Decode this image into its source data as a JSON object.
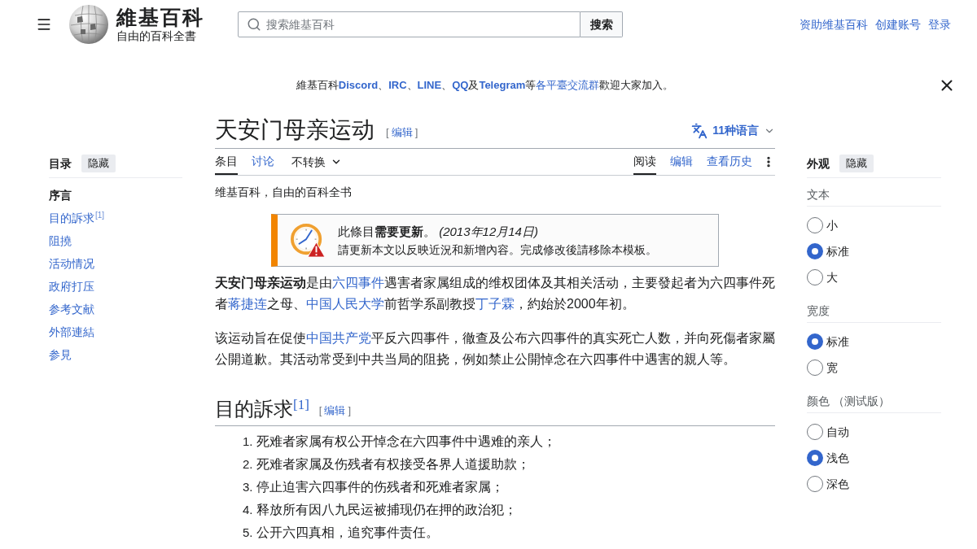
{
  "header": {
    "site_name": "維基百科",
    "tagline": "自由的百科全書",
    "search": {
      "placeholder": "搜索維基百科",
      "button": "搜索"
    },
    "user_links": [
      "资助维基百科",
      "创建账号",
      "登录"
    ]
  },
  "banner": {
    "segments": [
      {
        "kind": "text",
        "text": "維基百科"
      },
      {
        "kind": "bold_link",
        "text": "Discord"
      },
      {
        "kind": "text",
        "text": "、"
      },
      {
        "kind": "bold_link",
        "text": "IRC"
      },
      {
        "kind": "text",
        "text": "、"
      },
      {
        "kind": "bold_link",
        "text": "LINE"
      },
      {
        "kind": "text",
        "text": "、"
      },
      {
        "kind": "bold_link",
        "text": "QQ"
      },
      {
        "kind": "text",
        "text": "及"
      },
      {
        "kind": "bold_link",
        "text": "Telegram"
      },
      {
        "kind": "text",
        "text": "等"
      },
      {
        "kind": "link",
        "text": "各平臺交流群"
      },
      {
        "kind": "text",
        "text": "歡迎大家加入。"
      }
    ]
  },
  "toc": {
    "title": "目录",
    "hide_button": "隐藏",
    "items": [
      {
        "label": "序言",
        "selected": true
      },
      {
        "label": "目的訴求",
        "note": "[1]",
        "selected": false
      },
      {
        "label": "阻撓",
        "selected": false
      },
      {
        "label": "活动情况",
        "selected": false
      },
      {
        "label": "政府打压",
        "selected": false
      },
      {
        "label": "参考文献",
        "selected": false
      },
      {
        "label": "外部連結",
        "selected": false
      },
      {
        "label": "参見",
        "selected": false
      }
    ]
  },
  "article": {
    "title": "天安门母亲运动",
    "title_edit": {
      "open": "[",
      "label": "编辑",
      "close": "]"
    },
    "languages": "11种语言",
    "tabs": [
      {
        "label": "条目",
        "selected": true
      },
      {
        "label": "讨论",
        "selected": false
      }
    ],
    "variant": "不转换",
    "views": [
      {
        "label": "阅读",
        "selected": true
      },
      {
        "label": "编辑",
        "selected": false
      },
      {
        "label": "查看历史",
        "selected": false
      }
    ],
    "tagline": "维基百科，自由的百科全书",
    "notice": {
      "title": "此條目**需要更新**。 *(2013年12月14日)*",
      "text": "請更新本文以反映近況和新增內容。完成修改後請移除本模板。"
    },
    "paragraphs": [
      [
        {
          "kind": "bold",
          "text": "天安门母亲运动"
        },
        {
          "kind": "text",
          "text": "是由"
        },
        {
          "kind": "link",
          "text": "六四事件"
        },
        {
          "kind": "text",
          "text": "遇害者家属组成的维权团体及其相关活动，主要發起者为六四事件死者"
        },
        {
          "kind": "link",
          "text": "蒋捷连"
        },
        {
          "kind": "text",
          "text": "之母、"
        },
        {
          "kind": "link",
          "text": "中国人民大学"
        },
        {
          "kind": "text",
          "text": "前哲学系副教授"
        },
        {
          "kind": "link",
          "text": "丁子霖"
        },
        {
          "kind": "text",
          "text": "，約始於2000年初。"
        }
      ],
      [
        {
          "kind": "text",
          "text": "该运动旨在促使"
        },
        {
          "kind": "link",
          "text": "中国共产党"
        },
        {
          "kind": "text",
          "text": "平反六四事件，徹查及公布六四事件的真实死亡人数，并向死傷者家屬公開道歉。其活动常受到中共当局的阻挠，例如禁止公開悼念在六四事件中遇害的親人等。"
        }
      ]
    ],
    "sections": [
      {
        "heading": "目的訴求",
        "note": "[1]",
        "edit": {
          "open": "[",
          "label": "编辑",
          "close": "]"
        },
        "items": [
          {
            "number": "1.",
            "text": "死难者家属有权公开悼念在六四事件中遇难的亲人；"
          },
          {
            "number": "2.",
            "text": "死难者家属及伤残者有权接受各界人道援助款；"
          },
          {
            "number": "3.",
            "text": "停止迫害六四事件的伤残者和死难者家属；"
          },
          {
            "number": "4.",
            "text": "释放所有因八九民运被捕现仍在押的政治犯；"
          },
          {
            "number": "5.",
            "text": "公开六四真相，追究事件责任。"
          }
        ]
      }
    ]
  },
  "appearance": {
    "title": "外观",
    "hide_button": "隐藏",
    "groups": [
      {
        "label": "文本",
        "options": [
          {
            "label": "小",
            "selected": false
          },
          {
            "label": "标准",
            "selected": true
          },
          {
            "label": "大",
            "selected": false
          }
        ]
      },
      {
        "label": "宽度",
        "options": [
          {
            "label": "标准",
            "selected": true
          },
          {
            "label": "宽",
            "selected": false
          }
        ]
      },
      {
        "label": "颜色 （测试版）",
        "options": [
          {
            "label": "自动",
            "selected": false
          },
          {
            "label": "浅色",
            "selected": true
          },
          {
            "label": "深色",
            "selected": false
          }
        ]
      }
    ]
  }
}
